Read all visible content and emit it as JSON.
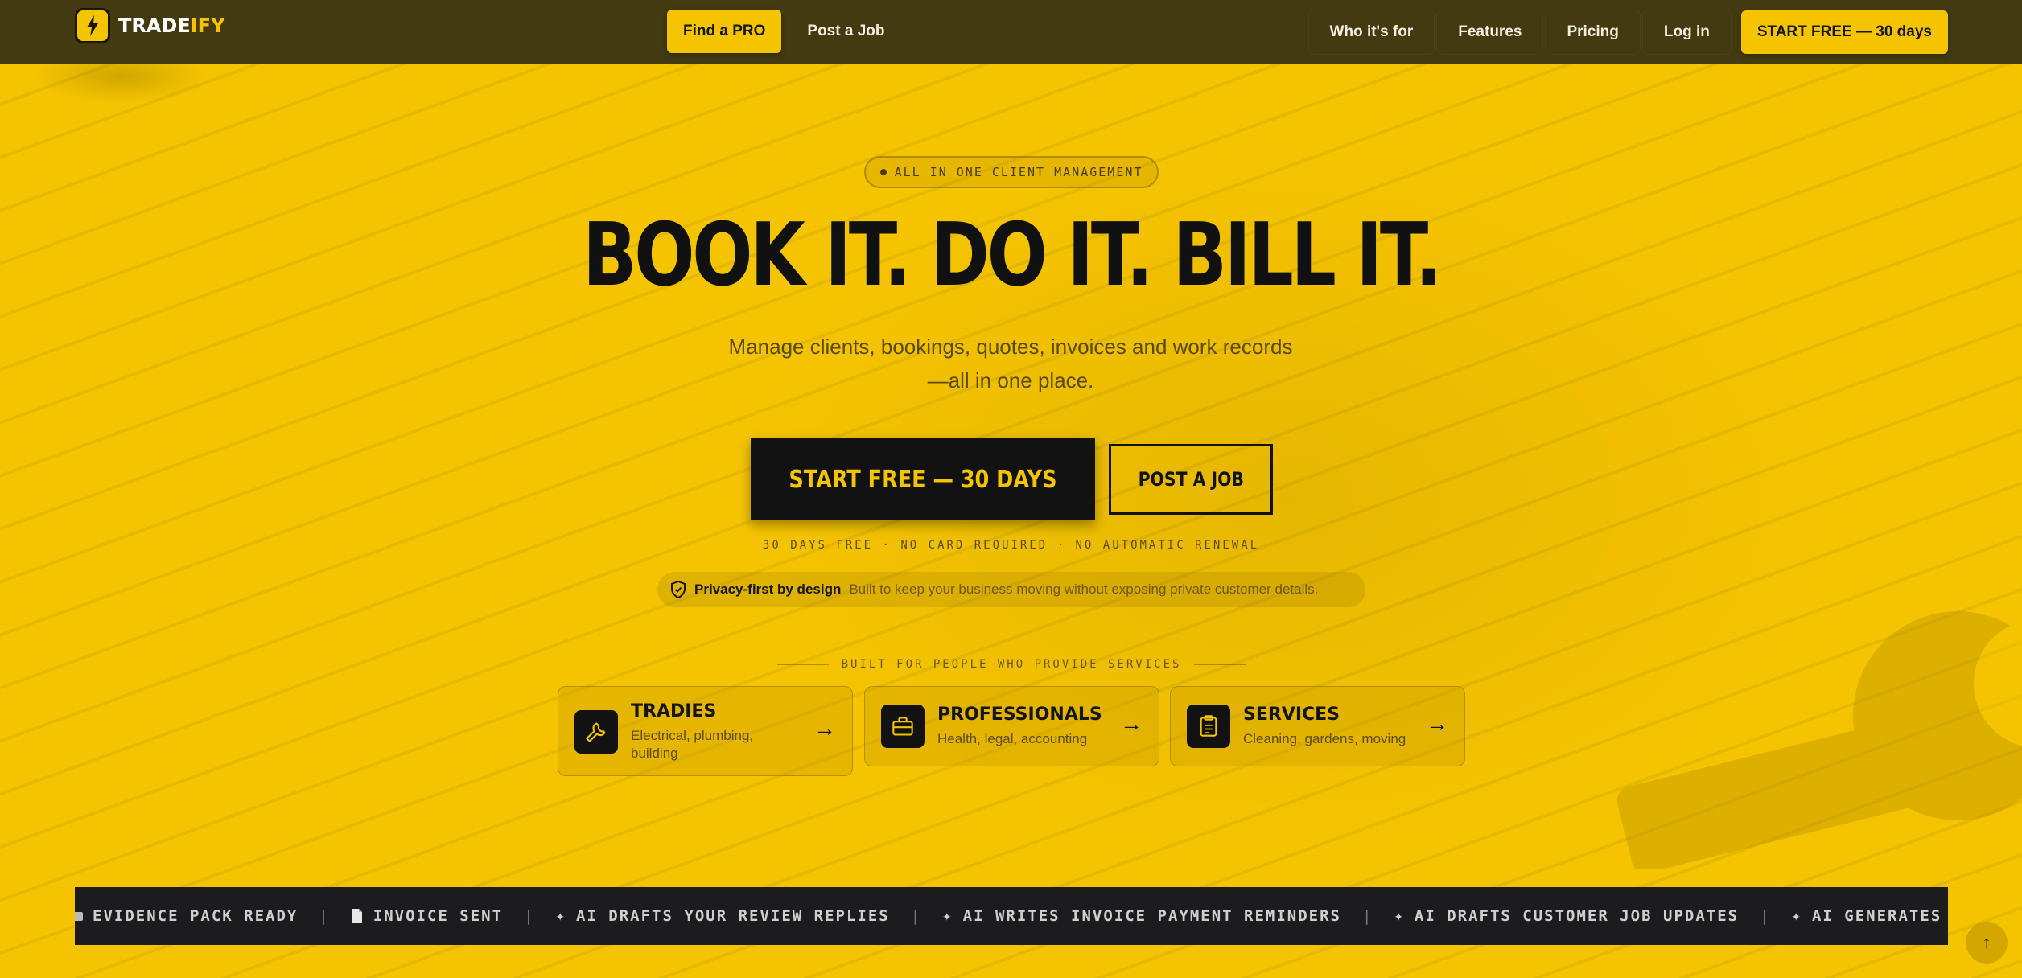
{
  "brand": {
    "logo_part1": "TRADE",
    "logo_part2": "IFY",
    "accent_color": "#f5c400",
    "header_color": "#433a10",
    "logo_icon": "lightning-bolt-icon"
  },
  "nav": {
    "find_pro": "Find a PRO",
    "post_job": "Post a Job",
    "right_links": [
      "Who it's for",
      "Features",
      "Pricing",
      "Log in"
    ],
    "start_free": "START FREE — 30 days"
  },
  "hero": {
    "eyebrow": "ALL IN ONE CLIENT MANAGEMENT",
    "headline": "BOOK IT. DO IT. BILL IT.",
    "subhead_line1": "Manage clients, bookings, quotes, invoices and work records",
    "subhead_line2": "—all in one place.",
    "cta_primary": "START FREE — 30 DAYS",
    "cta_secondary": "POST A JOB",
    "fineprint": "30 DAYS FREE · NO CARD REQUIRED · NO AUTOMATIC RENEWAL",
    "privacy_strong": "Privacy-first by design",
    "privacy_text": "Built to keep your business moving without exposing private customer details.",
    "privacy_icon": "shield-check-icon"
  },
  "built_for": {
    "label": "BUILT FOR PEOPLE WHO PROVIDE SERVICES",
    "cards": [
      {
        "title": "TRADIES",
        "desc_line1": "Electrical, plumbing,",
        "desc_line2": "building",
        "icon": "wrench-icon",
        "arrow": "→"
      },
      {
        "title": "PROFESSIONALS",
        "desc_line1": "Health, legal, accounting",
        "icon": "briefcase-icon",
        "arrow": "→"
      },
      {
        "title": "SERVICES",
        "desc_line1": "Cleaning, gardens, moving",
        "icon": "clipboard-icon",
        "arrow": "→"
      }
    ]
  },
  "ticker": {
    "items": [
      {
        "icon": "folder-icon",
        "glyph": "▬",
        "text": "EVIDENCE PACK READY"
      },
      {
        "icon": "document-icon",
        "glyph": "📄",
        "text": "INVOICE SENT"
      },
      {
        "icon": "sparkle-icon",
        "glyph": "✦",
        "text": "AI DRAFTS YOUR REVIEW REPLIES"
      },
      {
        "icon": "sparkle-icon",
        "glyph": "✦",
        "text": "AI WRITES INVOICE PAYMENT REMINDERS"
      },
      {
        "icon": "sparkle-icon",
        "glyph": "✦",
        "text": "AI DRAFTS CUSTOMER JOB UPDATES"
      },
      {
        "icon": "sparkle-icon",
        "glyph": "✦",
        "text": "AI GENERATES SERVICE D"
      }
    ],
    "separator": "|"
  },
  "scroll_top": {
    "glyph": "↑",
    "icon": "arrow-up-icon"
  }
}
